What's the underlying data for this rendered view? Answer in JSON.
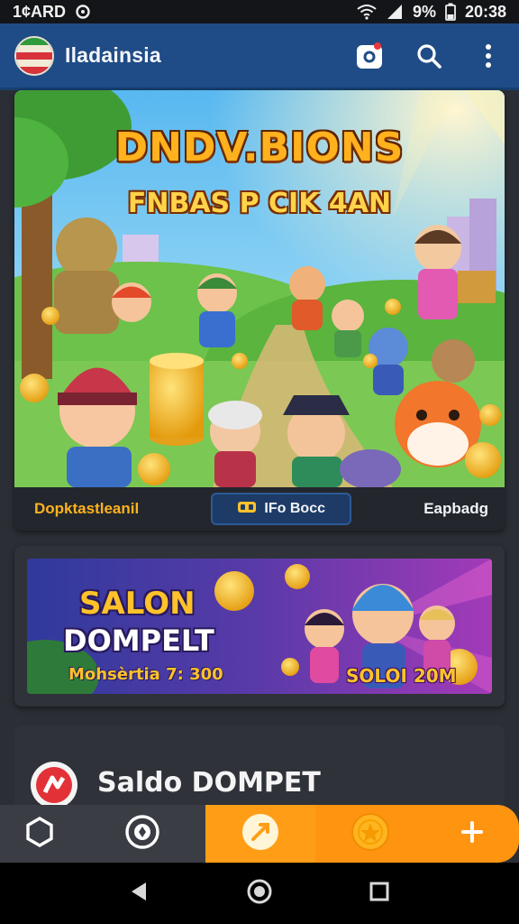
{
  "status_bar": {
    "carrier": "1¢ARD",
    "battery": "9%",
    "time": "20:38"
  },
  "app_bar": {
    "title": "Iladainsia",
    "icons": [
      "flag-logo-icon",
      "camera-icon",
      "search-icon",
      "more-vert-icon"
    ]
  },
  "hero": {
    "title": "DNDV.BIONS",
    "subtitle": "FNBAS P CIK 4AN",
    "tabs": {
      "left": "Dopktastleanil",
      "mid": "IFo Bocc",
      "right": "Eapbadg"
    }
  },
  "banner": {
    "title_line1": "SALON",
    "title_line2": "DOMPELT",
    "subtitle_left": "Mohsèrtia 7: 300",
    "subtitle_right": "SOLOI 20M"
  },
  "wallet": {
    "title": "Saldo DOMPET"
  },
  "bottom_nav": {
    "icons": [
      "hexagon-icon",
      "globe-icon",
      "arrow-icon",
      "coin-icon",
      "plus-icon"
    ]
  },
  "colors": {
    "app_bar": "#1f4c86",
    "accent_orange": "#ff9d16",
    "gold": "#ffb21e",
    "card_bg": "#2f3239"
  }
}
